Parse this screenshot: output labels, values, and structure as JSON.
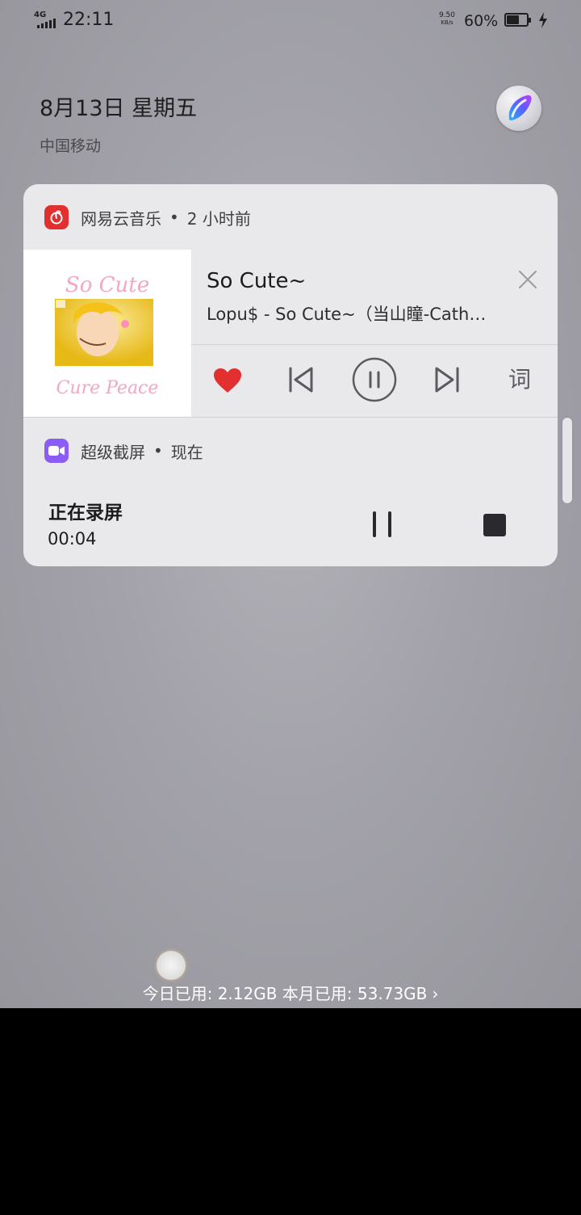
{
  "status_bar": {
    "network": "4G",
    "time": "22:11",
    "net_speed_value": "9.50",
    "net_speed_unit": "KB/s",
    "battery_percent": "60%",
    "battery_level": 0.6,
    "charging": true
  },
  "lockscreen": {
    "date": "8月13日 星期五",
    "carrier": "中国移动"
  },
  "music_notification": {
    "app_name": "网易云音乐",
    "time_ago": "2 小时前",
    "song_title": "So Cute~",
    "song_subtitle": "Lopu$ - So Cute~（当山瞳-Cath…",
    "album_art_text_top": "So Cute",
    "album_art_text_bottom": "Cure Peace",
    "lyrics_button_label": "词",
    "accent_color": "#e22f2f"
  },
  "record_notification": {
    "app_name": "超级截屏",
    "time_ago": "现在",
    "title": "正在录屏",
    "elapsed": "00:04",
    "accent_color": "#8b5cf6"
  },
  "footer": {
    "data_usage": "今日已用: 2.12GB 本月已用: 53.73GB",
    "chevron": "›"
  }
}
